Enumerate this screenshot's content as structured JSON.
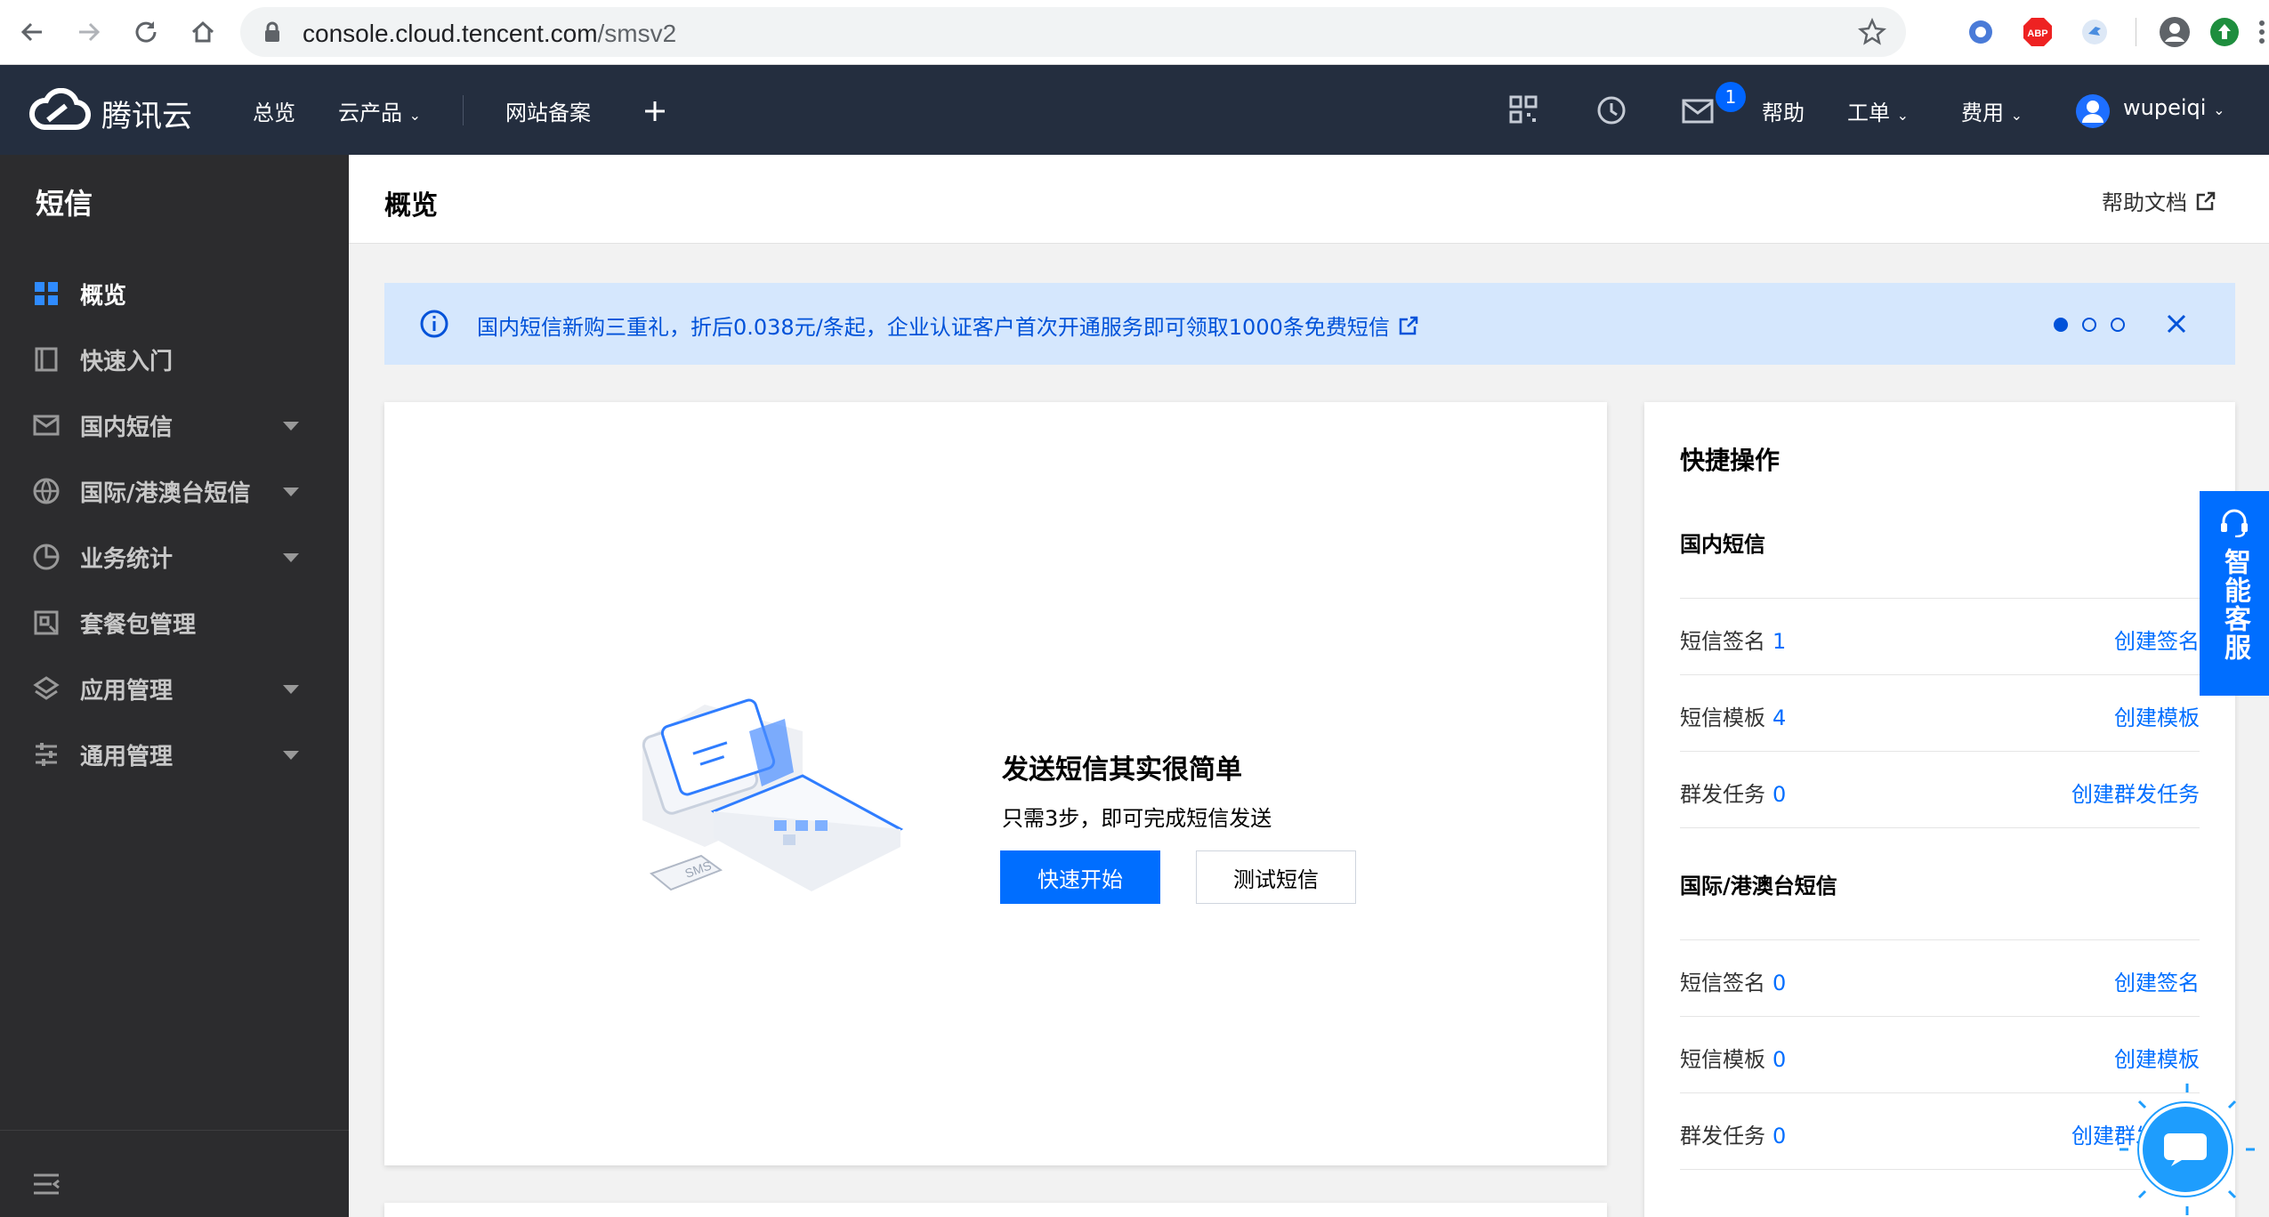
{
  "browser": {
    "url_host": "console.cloud.tencent.com",
    "url_path": "/smsv2"
  },
  "topnav": {
    "brand": "腾讯云",
    "overview": "总览",
    "products": "云产品",
    "icp": "网站备案",
    "mail_badge": "1",
    "help": "帮助",
    "ticket": "工单",
    "billing": "费用",
    "user": "wupeiqi"
  },
  "sidebar": {
    "title": "短信",
    "items": [
      {
        "label": "概览",
        "icon": "grid-icon"
      },
      {
        "label": "快速入门",
        "icon": "book-icon"
      },
      {
        "label": "国内短信",
        "icon": "mail-icon"
      },
      {
        "label": "国际/港澳台短信",
        "icon": "globe-icon"
      },
      {
        "label": "业务统计",
        "icon": "pie-chart-icon"
      },
      {
        "label": "套餐包管理",
        "icon": "package-icon"
      },
      {
        "label": "应用管理",
        "icon": "layers-icon"
      },
      {
        "label": "通用管理",
        "icon": "sliders-icon"
      }
    ]
  },
  "header": {
    "title": "概览",
    "help_doc": "帮助文档"
  },
  "banner": {
    "text": "国内短信新购三重礼，折后0.038元/条起，企业认证客户首次开通服务即可领取1000条免费短信"
  },
  "hero": {
    "title": "发送短信其实很简单",
    "subtitle": "只需3步，即可完成短信发送",
    "primary_button": "快速开始",
    "secondary_button": "测试短信",
    "illustration_text": "SMS"
  },
  "quick_ops": {
    "title": "快捷操作",
    "domestic": {
      "section": "国内短信",
      "rows": [
        {
          "label": "短信签名",
          "count": "1",
          "action": "创建签名"
        },
        {
          "label": "短信模板",
          "count": "4",
          "action": "创建模板"
        },
        {
          "label": "群发任务",
          "count": "0",
          "action": "创建群发任务"
        }
      ]
    },
    "intl": {
      "section": "国际/港澳台短信",
      "rows": [
        {
          "label": "短信签名",
          "count": "0",
          "action": "创建签名"
        },
        {
          "label": "短信模板",
          "count": "0",
          "action": "创建模板"
        },
        {
          "label": "群发任务",
          "count": "0",
          "action": "创建群发任务"
        }
      ]
    }
  },
  "float": {
    "customer_service": "智能客服"
  },
  "colors": {
    "nav_bg": "#242e3f",
    "sidebar_bg": "#2c2c2e",
    "accent": "#006eff",
    "banner_bg": "#d5e7fd"
  }
}
